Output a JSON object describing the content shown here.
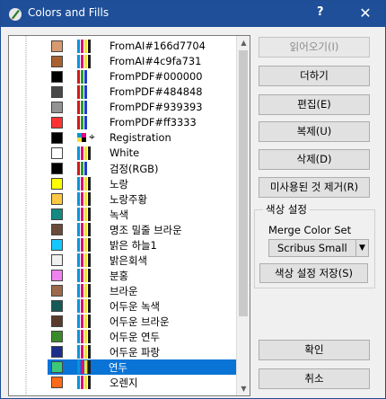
{
  "window": {
    "title": "Colors and Fills",
    "help_label": "?",
    "close_label": "✕"
  },
  "colors": [
    {
      "name": "FromAI#166d7704",
      "swatch": "#d89a70",
      "model": "cmyk"
    },
    {
      "name": "FromAI#4c9fa731",
      "swatch": "#a86030",
      "model": "cmyk"
    },
    {
      "name": "FromPDF#000000",
      "swatch": "#000000",
      "model": "rgb"
    },
    {
      "name": "FromPDF#484848",
      "swatch": "#484848",
      "model": "rgb"
    },
    {
      "name": "FromPDF#939393",
      "swatch": "#939393",
      "model": "rgb"
    },
    {
      "name": "FromPDF#ff3333",
      "swatch": "#ff3333",
      "model": "rgb"
    },
    {
      "name": "Registration",
      "swatch": "#000000",
      "model": "registration"
    },
    {
      "name": "White",
      "swatch": "#ffffff",
      "model": "cmyk"
    },
    {
      "name": "검정(RGB)",
      "swatch": "#000000",
      "model": "rgb"
    },
    {
      "name": "노랑",
      "swatch": "#ffff00",
      "model": "cmyk"
    },
    {
      "name": "노랑주황",
      "swatch": "#ffc843",
      "model": "cmyk"
    },
    {
      "name": "녹색",
      "swatch": "#148a82",
      "model": "cmyk"
    },
    {
      "name": "명조 밀줄 브라운",
      "swatch": "#6b4a3a",
      "model": "cmyk"
    },
    {
      "name": "밝은 하늘1",
      "swatch": "#14c8ff",
      "model": "cmyk"
    },
    {
      "name": "밝은회색",
      "swatch": "#f0f0f0",
      "model": "cmyk"
    },
    {
      "name": "분홍",
      "swatch": "#ee82ee",
      "model": "cmyk"
    },
    {
      "name": "브라운",
      "swatch": "#9c6a4a",
      "model": "cmyk"
    },
    {
      "name": "어두운 녹색",
      "swatch": "#145a56",
      "model": "cmyk"
    },
    {
      "name": "어두운 브라운",
      "swatch": "#5a3a2a",
      "model": "cmyk"
    },
    {
      "name": "어두운 연두",
      "swatch": "#3a8a2a",
      "model": "cmyk"
    },
    {
      "name": "어두운 파랑",
      "swatch": "#1a2e8a",
      "model": "cmyk"
    },
    {
      "name": "연두",
      "swatch": "#3cc878",
      "model": "cmyk"
    },
    {
      "name": "오렌지",
      "swatch": "#ff6a1a",
      "model": "cmyk"
    }
  ],
  "selected_index": 21,
  "buttons": {
    "import": "읽어오기(I)",
    "new": "더하기",
    "edit": "편집(E)",
    "duplicate": "복제(U)",
    "delete": "삭제(D)",
    "remove_unused": "미사용된 것 제거(R)",
    "ok": "확인",
    "cancel": "취소"
  },
  "color_sets": {
    "group_title": "색상 설정",
    "merge_label": "Merge Color Set",
    "selected": "Scribus Small",
    "save_label": "색상 설정 저장(S)"
  }
}
